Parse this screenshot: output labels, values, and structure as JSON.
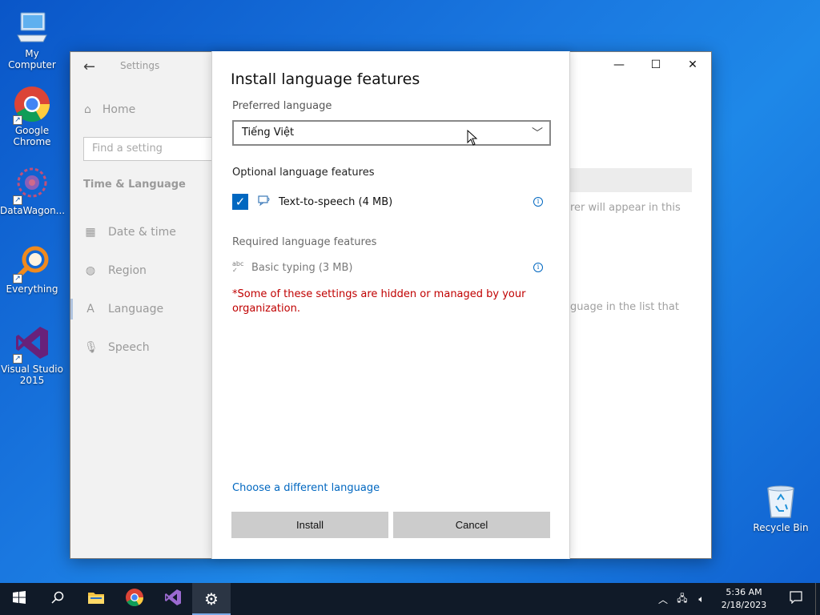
{
  "desktop": {
    "icons": [
      {
        "label": "My Computer",
        "icon": "computer-icon"
      },
      {
        "label": "Google Chrome",
        "icon": "chrome-icon"
      },
      {
        "label": "DataWagon...",
        "icon": "datawagon-icon"
      },
      {
        "label": "Everything",
        "icon": "everything-icon"
      },
      {
        "label": "Visual Studio 2015",
        "icon": "visual-studio-icon"
      }
    ],
    "recycle_bin": "Recycle Bin"
  },
  "settings": {
    "app_title": "Settings",
    "home": "Home",
    "search_placeholder": "Find a setting",
    "section": "Time & Language",
    "nav": [
      {
        "label": "Date & time",
        "icon": "calendar-clock-icon"
      },
      {
        "label": "Region",
        "icon": "globe-icon"
      },
      {
        "label": "Language",
        "icon": "language-icon"
      },
      {
        "label": "Speech",
        "icon": "microphone-icon"
      }
    ],
    "bg_text_1": "rer will appear in this",
    "bg_text_2": "guage in the list that"
  },
  "dialog": {
    "title": "Install language features",
    "preferred_label": "Preferred language",
    "preferred_value": "Tiếng Việt",
    "optional_label": "Optional language features",
    "optional_feature": "Text-to-speech (4 MB)",
    "optional_checked": true,
    "required_label": "Required language features",
    "required_feature": "Basic typing (3 MB)",
    "warning": "*Some of these settings are hidden or managed by your organization.",
    "link": "Choose a different language",
    "install": "Install",
    "cancel": "Cancel"
  },
  "taskbar": {
    "time": "5:36 AM",
    "date": "2/18/2023"
  },
  "colors": {
    "accent": "#0067c0",
    "warning": "#c00000",
    "taskbar": "#101a28"
  }
}
